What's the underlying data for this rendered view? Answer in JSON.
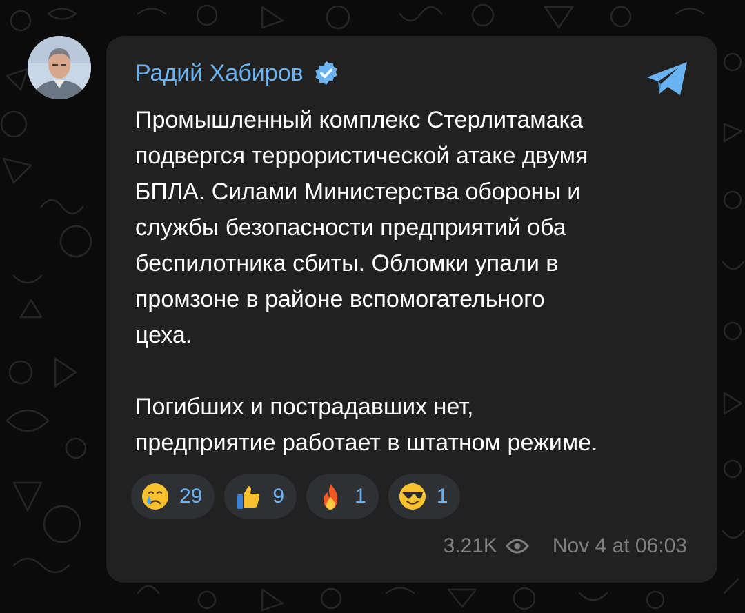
{
  "post": {
    "sender_name": "Радий Хабиров",
    "verified": true,
    "text_lines": [
      "Промышленный комплекс Стерлитамака",
      "подвергся террористической атаке двумя",
      "БПЛА. Силами Министерства обороны и",
      "службы безопасности предприятий оба",
      "беспилотника сбиты. Обломки упали в",
      "промзоне в районе вспомогательного",
      "цеха.",
      "",
      "Погибших и пострадавших нет,",
      "предприятие работает в штатном режиме."
    ],
    "reactions": [
      {
        "emoji": "crying-face",
        "count": "29"
      },
      {
        "emoji": "thumbs-up",
        "count": "9"
      },
      {
        "emoji": "fire",
        "count": "1"
      },
      {
        "emoji": "smiling-face-with-sunglasses",
        "count": "1"
      }
    ],
    "views": "3.21K",
    "timestamp": "Nov 4 at 06:03"
  },
  "colors": {
    "background": "#0b0b0b",
    "bubble": "#212121",
    "accent": "#6ab3f3",
    "text": "#ffffff",
    "meta": "#7f7f7f",
    "reaction_bg": "#2e3033"
  },
  "icons": {
    "verified": "verified-badge-icon",
    "telegram": "telegram-logo-icon",
    "views": "eye-icon"
  }
}
